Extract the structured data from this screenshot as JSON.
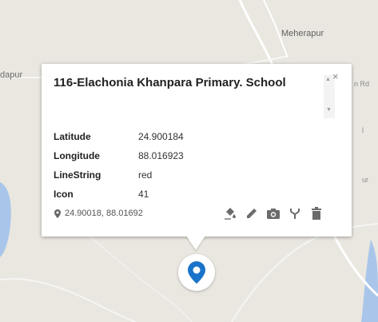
{
  "map": {
    "places": [
      "Meherapur",
      "dapur",
      "n Rd",
      "l",
      "ur"
    ]
  },
  "popup": {
    "title": "116-Elachonia Khanpara Primary. School",
    "close_label": "×",
    "attributes": [
      {
        "key": "Latitude",
        "value": "24.900184"
      },
      {
        "key": "Longitude",
        "value": "88.016923"
      },
      {
        "key": "LineString",
        "value": "red"
      },
      {
        "key": "Icon",
        "value": "41"
      }
    ],
    "coordinates": "24.90018, 88.01692",
    "tools": [
      "paint-bucket-icon",
      "pencil-icon",
      "camera-icon",
      "fork-icon",
      "trash-icon"
    ]
  },
  "marker": {
    "color": "#1a73c8",
    "icon": "location-pin-icon"
  },
  "colors": {
    "map_bg": "#eae7e0",
    "water": "#a9c6ea",
    "road": "#ffffff",
    "tool_icon": "#6b6b6b"
  }
}
